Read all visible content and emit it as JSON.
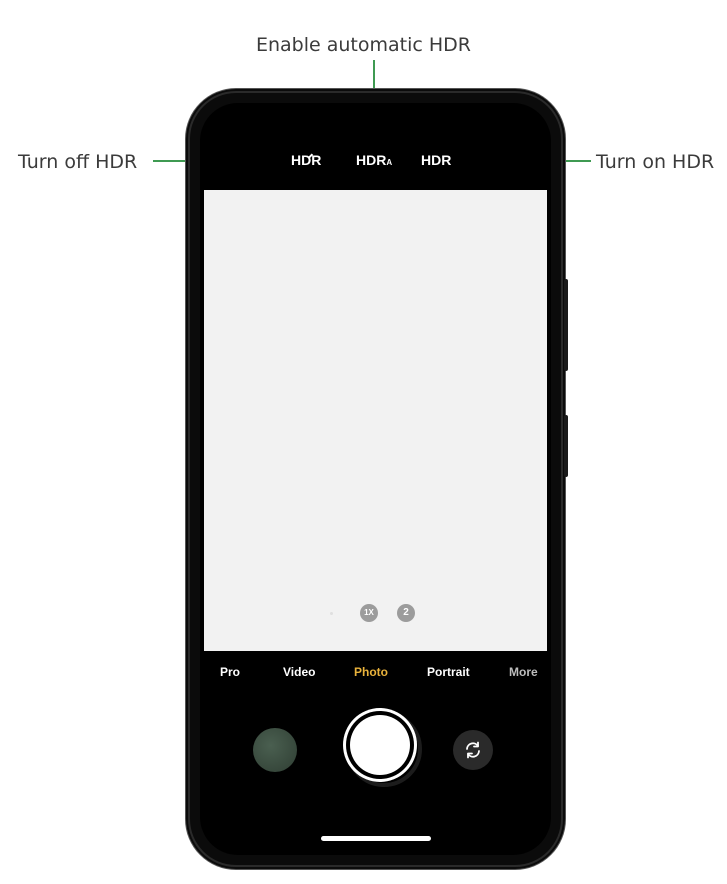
{
  "callouts": {
    "top": "Enable automatic HDR",
    "left": "Turn off HDR",
    "right": "Turn on HDR"
  },
  "hdr_options": {
    "off": "HDR",
    "auto_main": "HDR",
    "auto_sub": "A",
    "on": "HDR"
  },
  "zoom": {
    "level_1": "1X",
    "level_2": "2"
  },
  "modes": [
    "Pro",
    "Video",
    "Photo",
    "Portrait",
    "More"
  ],
  "active_mode": "Photo",
  "colors": {
    "accent_green": "#3f9a52",
    "active_mode": "#e9b23b",
    "viewfinder": "#f2f2f2"
  },
  "icons": {
    "switch_camera": "switch-camera-icon",
    "gallery": "gallery-thumbnail"
  }
}
